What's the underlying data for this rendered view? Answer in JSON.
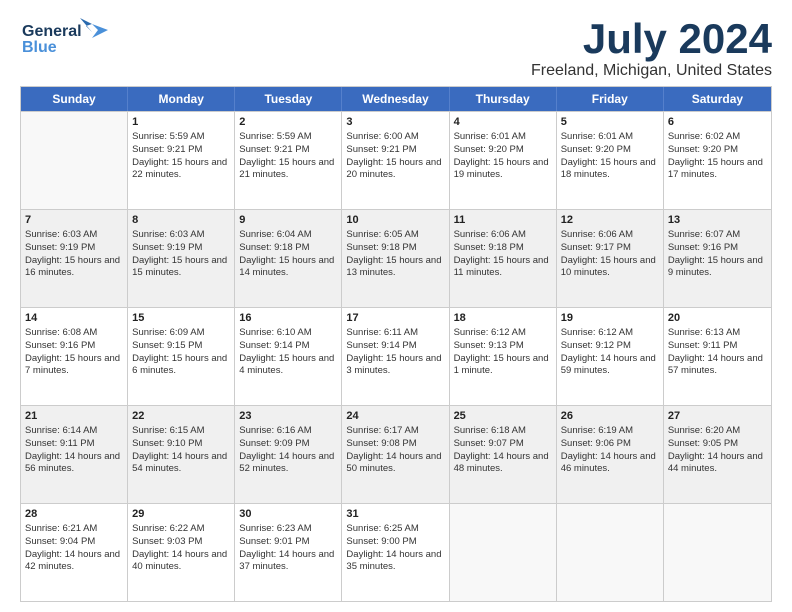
{
  "logo": {
    "line1": "General",
    "line2": "Blue"
  },
  "title": "July 2024",
  "subtitle": "Freeland, Michigan, United States",
  "weekdays": [
    "Sunday",
    "Monday",
    "Tuesday",
    "Wednesday",
    "Thursday",
    "Friday",
    "Saturday"
  ],
  "weeks": [
    [
      {
        "day": "",
        "sunrise": "",
        "sunset": "",
        "daylight": "",
        "empty": true
      },
      {
        "day": "1",
        "sunrise": "Sunrise: 5:59 AM",
        "sunset": "Sunset: 9:21 PM",
        "daylight": "Daylight: 15 hours and 22 minutes."
      },
      {
        "day": "2",
        "sunrise": "Sunrise: 5:59 AM",
        "sunset": "Sunset: 9:21 PM",
        "daylight": "Daylight: 15 hours and 21 minutes."
      },
      {
        "day": "3",
        "sunrise": "Sunrise: 6:00 AM",
        "sunset": "Sunset: 9:21 PM",
        "daylight": "Daylight: 15 hours and 20 minutes."
      },
      {
        "day": "4",
        "sunrise": "Sunrise: 6:01 AM",
        "sunset": "Sunset: 9:20 PM",
        "daylight": "Daylight: 15 hours and 19 minutes."
      },
      {
        "day": "5",
        "sunrise": "Sunrise: 6:01 AM",
        "sunset": "Sunset: 9:20 PM",
        "daylight": "Daylight: 15 hours and 18 minutes."
      },
      {
        "day": "6",
        "sunrise": "Sunrise: 6:02 AM",
        "sunset": "Sunset: 9:20 PM",
        "daylight": "Daylight: 15 hours and 17 minutes."
      }
    ],
    [
      {
        "day": "7",
        "sunrise": "Sunrise: 6:03 AM",
        "sunset": "Sunset: 9:19 PM",
        "daylight": "Daylight: 15 hours and 16 minutes."
      },
      {
        "day": "8",
        "sunrise": "Sunrise: 6:03 AM",
        "sunset": "Sunset: 9:19 PM",
        "daylight": "Daylight: 15 hours and 15 minutes."
      },
      {
        "day": "9",
        "sunrise": "Sunrise: 6:04 AM",
        "sunset": "Sunset: 9:18 PM",
        "daylight": "Daylight: 15 hours and 14 minutes."
      },
      {
        "day": "10",
        "sunrise": "Sunrise: 6:05 AM",
        "sunset": "Sunset: 9:18 PM",
        "daylight": "Daylight: 15 hours and 13 minutes."
      },
      {
        "day": "11",
        "sunrise": "Sunrise: 6:06 AM",
        "sunset": "Sunset: 9:18 PM",
        "daylight": "Daylight: 15 hours and 11 minutes."
      },
      {
        "day": "12",
        "sunrise": "Sunrise: 6:06 AM",
        "sunset": "Sunset: 9:17 PM",
        "daylight": "Daylight: 15 hours and 10 minutes."
      },
      {
        "day": "13",
        "sunrise": "Sunrise: 6:07 AM",
        "sunset": "Sunset: 9:16 PM",
        "daylight": "Daylight: 15 hours and 9 minutes."
      }
    ],
    [
      {
        "day": "14",
        "sunrise": "Sunrise: 6:08 AM",
        "sunset": "Sunset: 9:16 PM",
        "daylight": "Daylight: 15 hours and 7 minutes."
      },
      {
        "day": "15",
        "sunrise": "Sunrise: 6:09 AM",
        "sunset": "Sunset: 9:15 PM",
        "daylight": "Daylight: 15 hours and 6 minutes."
      },
      {
        "day": "16",
        "sunrise": "Sunrise: 6:10 AM",
        "sunset": "Sunset: 9:14 PM",
        "daylight": "Daylight: 15 hours and 4 minutes."
      },
      {
        "day": "17",
        "sunrise": "Sunrise: 6:11 AM",
        "sunset": "Sunset: 9:14 PM",
        "daylight": "Daylight: 15 hours and 3 minutes."
      },
      {
        "day": "18",
        "sunrise": "Sunrise: 6:12 AM",
        "sunset": "Sunset: 9:13 PM",
        "daylight": "Daylight: 15 hours and 1 minute."
      },
      {
        "day": "19",
        "sunrise": "Sunrise: 6:12 AM",
        "sunset": "Sunset: 9:12 PM",
        "daylight": "Daylight: 14 hours and 59 minutes."
      },
      {
        "day": "20",
        "sunrise": "Sunrise: 6:13 AM",
        "sunset": "Sunset: 9:11 PM",
        "daylight": "Daylight: 14 hours and 57 minutes."
      }
    ],
    [
      {
        "day": "21",
        "sunrise": "Sunrise: 6:14 AM",
        "sunset": "Sunset: 9:11 PM",
        "daylight": "Daylight: 14 hours and 56 minutes."
      },
      {
        "day": "22",
        "sunrise": "Sunrise: 6:15 AM",
        "sunset": "Sunset: 9:10 PM",
        "daylight": "Daylight: 14 hours and 54 minutes."
      },
      {
        "day": "23",
        "sunrise": "Sunrise: 6:16 AM",
        "sunset": "Sunset: 9:09 PM",
        "daylight": "Daylight: 14 hours and 52 minutes."
      },
      {
        "day": "24",
        "sunrise": "Sunrise: 6:17 AM",
        "sunset": "Sunset: 9:08 PM",
        "daylight": "Daylight: 14 hours and 50 minutes."
      },
      {
        "day": "25",
        "sunrise": "Sunrise: 6:18 AM",
        "sunset": "Sunset: 9:07 PM",
        "daylight": "Daylight: 14 hours and 48 minutes."
      },
      {
        "day": "26",
        "sunrise": "Sunrise: 6:19 AM",
        "sunset": "Sunset: 9:06 PM",
        "daylight": "Daylight: 14 hours and 46 minutes."
      },
      {
        "day": "27",
        "sunrise": "Sunrise: 6:20 AM",
        "sunset": "Sunset: 9:05 PM",
        "daylight": "Daylight: 14 hours and 44 minutes."
      }
    ],
    [
      {
        "day": "28",
        "sunrise": "Sunrise: 6:21 AM",
        "sunset": "Sunset: 9:04 PM",
        "daylight": "Daylight: 14 hours and 42 minutes."
      },
      {
        "day": "29",
        "sunrise": "Sunrise: 6:22 AM",
        "sunset": "Sunset: 9:03 PM",
        "daylight": "Daylight: 14 hours and 40 minutes."
      },
      {
        "day": "30",
        "sunrise": "Sunrise: 6:23 AM",
        "sunset": "Sunset: 9:01 PM",
        "daylight": "Daylight: 14 hours and 37 minutes."
      },
      {
        "day": "31",
        "sunrise": "Sunrise: 6:25 AM",
        "sunset": "Sunset: 9:00 PM",
        "daylight": "Daylight: 14 hours and 35 minutes."
      },
      {
        "day": "",
        "sunrise": "",
        "sunset": "",
        "daylight": "",
        "empty": true
      },
      {
        "day": "",
        "sunrise": "",
        "sunset": "",
        "daylight": "",
        "empty": true
      },
      {
        "day": "",
        "sunrise": "",
        "sunset": "",
        "daylight": "",
        "empty": true
      }
    ]
  ]
}
